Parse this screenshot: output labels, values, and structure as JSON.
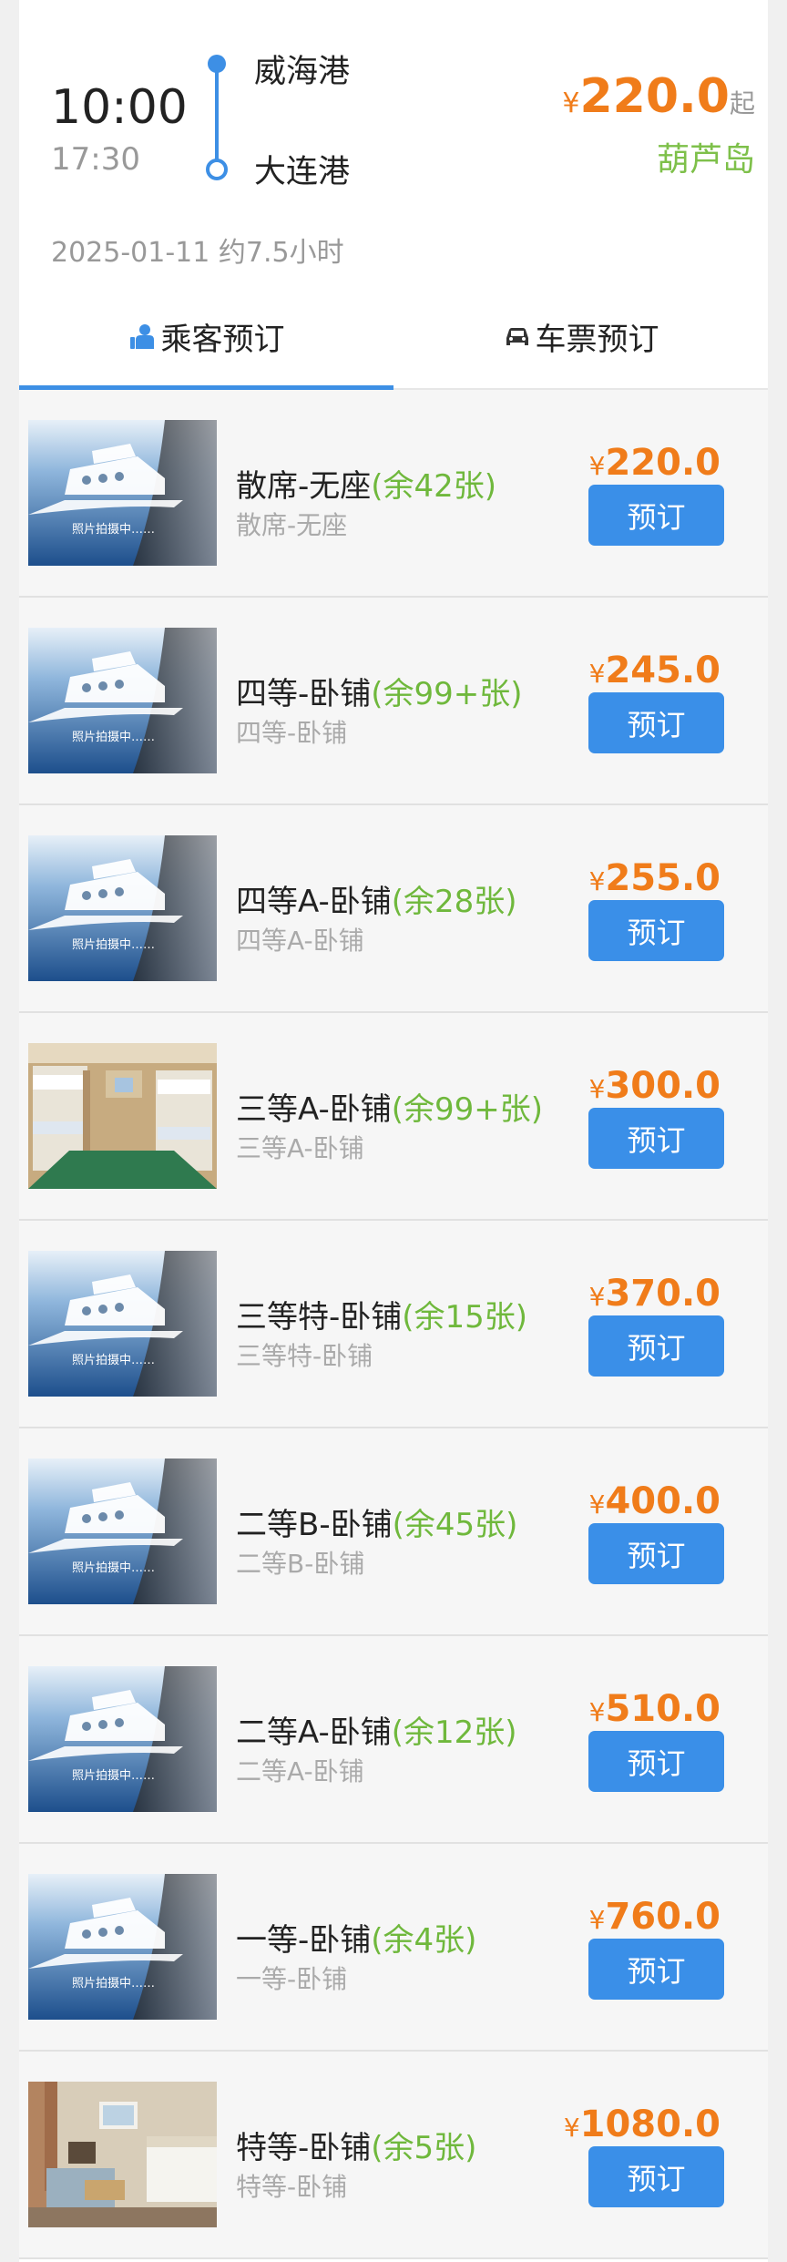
{
  "voyage": {
    "departure_time": "10:00",
    "arrival_time": "17:30",
    "from_port": "威海港",
    "to_port": "大连港",
    "currency": "¥",
    "min_price": "220.0",
    "price_suffix": "起",
    "ship_name": "葫芦岛",
    "date_duration": "2025-01-11 约7.5小时"
  },
  "tabs": [
    {
      "label": "乘客预订",
      "icon": "passenger-icon",
      "active": true
    },
    {
      "label": "车票预订",
      "icon": "car-icon",
      "active": false
    }
  ],
  "tickets": [
    {
      "name": "散席-无座",
      "availability": "(余42张)",
      "subtitle": "散席-无座",
      "price": "220.0",
      "image": "ship-placeholder",
      "button": "预订"
    },
    {
      "name": "四等-卧铺",
      "availability": "(余99+张)",
      "subtitle": "四等-卧铺",
      "price": "245.0",
      "image": "ship-placeholder",
      "button": "预订"
    },
    {
      "name": "四等A-卧铺",
      "availability": "(余28张)",
      "subtitle": "四等A-卧铺",
      "price": "255.0",
      "image": "ship-placeholder",
      "button": "预订"
    },
    {
      "name": "三等A-卧铺",
      "availability": "(余99+张)",
      "subtitle": "三等A-卧铺",
      "price": "300.0",
      "image": "cabin-bunk",
      "button": "预订"
    },
    {
      "name": "三等特-卧铺",
      "availability": "(余15张)",
      "subtitle": "三等特-卧铺",
      "price": "370.0",
      "image": "ship-placeholder",
      "button": "预订"
    },
    {
      "name": "二等B-卧铺",
      "availability": "(余45张)",
      "subtitle": "二等B-卧铺",
      "price": "400.0",
      "image": "ship-placeholder",
      "button": "预订"
    },
    {
      "name": "二等A-卧铺",
      "availability": "(余12张)",
      "subtitle": "二等A-卧铺",
      "price": "510.0",
      "image": "ship-placeholder",
      "button": "预订"
    },
    {
      "name": "一等-卧铺",
      "availability": "(余4张)",
      "subtitle": "一等-卧铺",
      "price": "760.0",
      "image": "ship-placeholder",
      "button": "预订"
    },
    {
      "name": "特等-卧铺",
      "availability": "(余5张)",
      "subtitle": "特等-卧铺",
      "price": "1080.0",
      "image": "cabin-suite",
      "button": "预订"
    }
  ],
  "placeholder_caption": "照片拍摄中……",
  "colors": {
    "accent_blue": "#3a8fe8",
    "price_orange": "#f07c1a",
    "availability_green": "#6fb83c"
  }
}
